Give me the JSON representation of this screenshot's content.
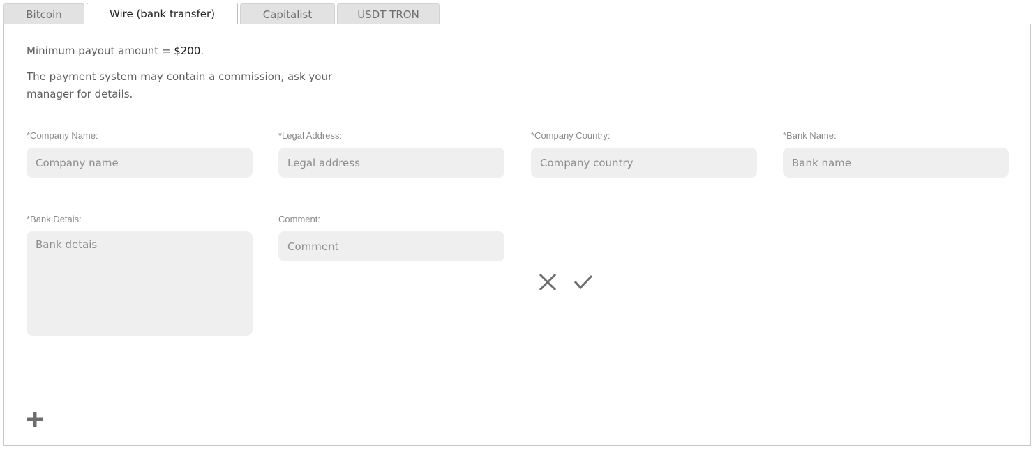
{
  "tabs": [
    {
      "label": "Bitcoin"
    },
    {
      "label": "Wire (bank transfer)"
    },
    {
      "label": "Capitalist"
    },
    {
      "label": "USDT TRON"
    }
  ],
  "active_tab": "Wire (bank transfer)",
  "info": {
    "minimum_prefix": "Minimum payout amount = ",
    "minimum_amount": "$200",
    "minimum_suffix": ".",
    "commission_line1": "The payment system may contain a commission, ask your",
    "commission_line2": "manager for details."
  },
  "form": {
    "company_name": {
      "label": "*Company Name:",
      "placeholder": "Company name",
      "value": ""
    },
    "legal_address": {
      "label": "*Legal Address:",
      "placeholder": "Legal address",
      "value": ""
    },
    "company_country": {
      "label": "*Company Country:",
      "placeholder": "Company country",
      "value": ""
    },
    "bank_name": {
      "label": "*Bank Name:",
      "placeholder": "Bank name",
      "value": ""
    },
    "bank_details": {
      "label": "*Bank Detais:",
      "placeholder": "Bank detais",
      "value": ""
    },
    "comment": {
      "label": "Comment:",
      "placeholder": "Comment",
      "value": ""
    }
  },
  "actions": {
    "cancel_icon": "close-icon",
    "confirm_icon": "check-icon",
    "add_icon": "plus-icon"
  },
  "colors": {
    "icon": "#6e6e6e",
    "input_bg": "#efefef",
    "tab_bg": "#e2e2e2"
  }
}
